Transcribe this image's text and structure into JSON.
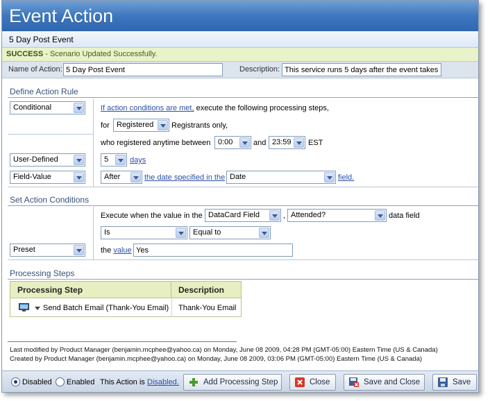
{
  "window": {
    "title": "Event Action",
    "subtitle": "5 Day Post Event"
  },
  "message": {
    "status": "SUCCESS",
    "separator": " - ",
    "text": "Scenario Updated Successfully."
  },
  "name_bar": {
    "name_label": "Name of Action:",
    "name_value": "5 Day Post Event",
    "description_label": "Description:",
    "description_value": "This service runs 5 days after the event takes"
  },
  "define_rule": {
    "title": "Define Action Rule",
    "condition_type": "Conditional",
    "if_link": "If action conditions are met,",
    "if_text": "execute the following processing steps,",
    "for_label": "for",
    "registrant_type": "Registered",
    "registrants_only": "Registrants only,",
    "who_registered": "who registered anytime between",
    "time_from": "0:00",
    "and_label": "and",
    "time_to": "23:59",
    "timezone": "EST",
    "interval_type": "User-Defined",
    "days_value": "5",
    "days_link": "days",
    "relation_type": "Field-Value",
    "after_value": "After",
    "date_specified_link": "the date specified in the",
    "date_field": "Date",
    "field_link": "field."
  },
  "conditions": {
    "title": "Set Action Conditions",
    "execute_when": "Execute when the value in the",
    "field_source": "DataCard Field",
    "comma": ",",
    "field_name": "Attended?",
    "data_field": "data field",
    "operator1": "Is",
    "operator2": "Equal to",
    "value_type": "Preset",
    "the_label": "the",
    "value_link": "value",
    "value": "Yes"
  },
  "processing": {
    "title": "Processing Steps",
    "columns": [
      "Processing Step",
      "Description"
    ],
    "rows": [
      {
        "step": "Send Batch Email (Thank-You Email)",
        "description": "Thank-You Email"
      }
    ]
  },
  "audit": {
    "modified": "Last modified by Product Manager (benjamin.mcphee@yahoo.ca) on Monday, June 08 2009, 04:28 PM (GMT-05:00) Eastern Time (US & Canada)",
    "created": "Created by Product Manager (benjamin.mcphee@yahoo.ca) on Monday, June 08 2009, 03:06 PM (GMT-05:00) Eastern Time (US & Canada)"
  },
  "toolbar": {
    "disabled_label": "Disabled",
    "enabled_label": "Enabled",
    "selected_state": "Disabled",
    "status_prefix": "This Action is",
    "status_link": "Disabled.",
    "add_step": "Add Processing Step",
    "close": "Close",
    "save_close": "Save and Close",
    "save": "Save"
  },
  "colors": {
    "title_bar": "#3d77be",
    "success_bg": "#e9f3c9",
    "link": "#2a4fa8",
    "table_header": "#e7efc2"
  }
}
